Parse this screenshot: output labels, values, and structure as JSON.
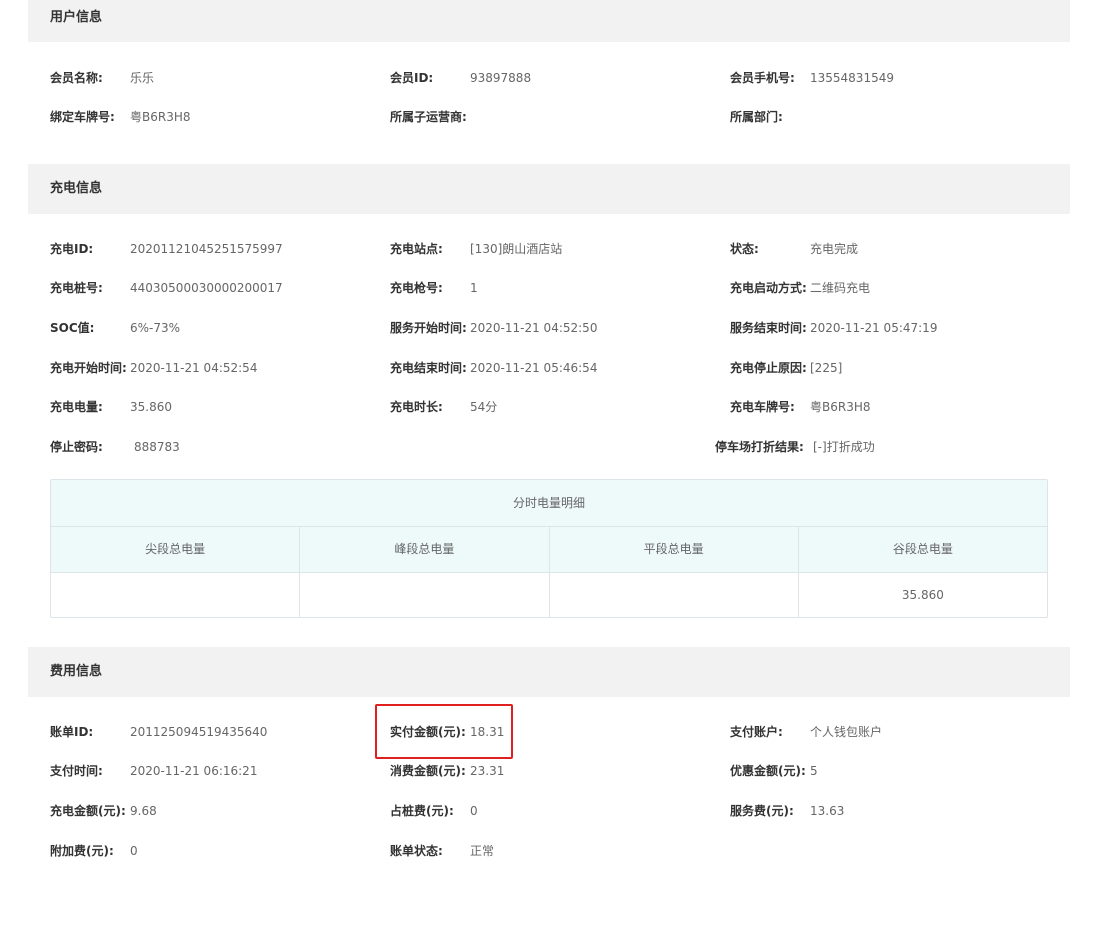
{
  "user_section": {
    "title": "用户信息",
    "fields": [
      {
        "label": "会员名称:",
        "value": "乐乐"
      },
      {
        "label": "会员ID:",
        "value": "93897888"
      },
      {
        "label": "会员手机号:",
        "value": "13554831549"
      },
      {
        "label": "绑定车牌号:",
        "value": "粤B6R3H8"
      },
      {
        "label": "所属子运营商:",
        "value": ""
      },
      {
        "label": "所属部门:",
        "value": ""
      }
    ]
  },
  "charge_section": {
    "title": "充电信息",
    "fields": [
      {
        "label": "充电ID:",
        "value": "20201121045251575997"
      },
      {
        "label": "充电站点:",
        "value": "[130]朗山酒店站"
      },
      {
        "label": "状态:",
        "value": "充电完成"
      },
      {
        "label": "充电桩号:",
        "value": "44030500030000200017"
      },
      {
        "label": "充电枪号:",
        "value": "1"
      },
      {
        "label": "充电启动方式:",
        "value": "二维码充电"
      },
      {
        "label": "SOC值:",
        "value": "6%-73%"
      },
      {
        "label": "服务开始时间:",
        "value": "2020-11-21 04:52:50"
      },
      {
        "label": "服务结束时间:",
        "value": "2020-11-21 05:47:19"
      },
      {
        "label": "充电开始时间:",
        "value": "2020-11-21 04:52:54"
      },
      {
        "label": "充电结束时间:",
        "value": "2020-11-21 05:46:54"
      },
      {
        "label": "充电停止原因:",
        "value": "[225]"
      },
      {
        "label": "充电电量:",
        "value": "35.860"
      },
      {
        "label": "充电时长:",
        "value": "54分"
      },
      {
        "label": "充电车牌号:",
        "value": "粤B6R3H8"
      },
      {
        "label": "停止密码:",
        "value": "888783"
      },
      {
        "label": "停车场打折结果:",
        "value": "[-]打折成功"
      }
    ],
    "detail": {
      "title": "分时电量明细",
      "headers": [
        "尖段总电量",
        "峰段总电量",
        "平段总电量",
        "谷段总电量"
      ],
      "values": [
        "",
        "",
        "",
        "35.860"
      ]
    }
  },
  "fee_section": {
    "title": "费用信息",
    "fields": [
      {
        "label": "账单ID:",
        "value": "201125094519435640"
      },
      {
        "label": "实付金额(元):",
        "value": "18.31"
      },
      {
        "label": "支付账户:",
        "value": "个人钱包账户"
      },
      {
        "label": "支付时间:",
        "value": "2020-11-21 06:16:21"
      },
      {
        "label": "消费金额(元):",
        "value": "23.31"
      },
      {
        "label": "优惠金额(元):",
        "value": "5"
      },
      {
        "label": "充电金额(元):",
        "value": "9.68"
      },
      {
        "label": "占桩费(元):",
        "value": "0"
      },
      {
        "label": "服务费(元):",
        "value": "13.63"
      },
      {
        "label": "附加费(元):",
        "value": "0"
      },
      {
        "label": "账单状态:",
        "value": "正常"
      }
    ]
  },
  "colors": {
    "section_bg": "#f2f2f2",
    "table_header_bg": "#eef9fa",
    "highlight_border": "#e02020"
  }
}
